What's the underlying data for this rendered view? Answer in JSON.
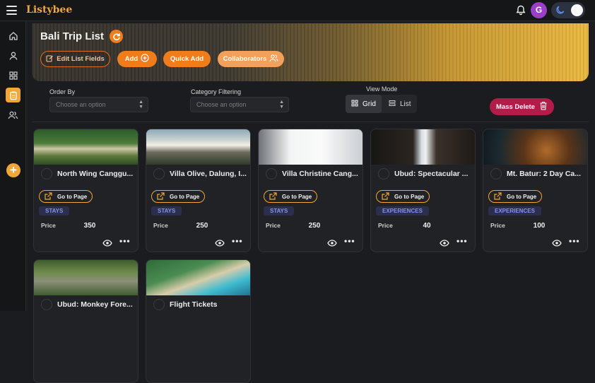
{
  "app": {
    "brand": "Listybee",
    "avatar_letter": "G"
  },
  "page": {
    "title": "Bali Trip List"
  },
  "toolbar": {
    "edit_fields": "Edit List Fields",
    "add": "Add",
    "quick_add": "Quick Add",
    "collaborators": "Collaborators"
  },
  "filters": {
    "order_by_label": "Order By",
    "order_by_placeholder": "Choose an option",
    "category_label": "Category Filtering",
    "category_placeholder": "Choose an option",
    "view_mode_label": "View Mode",
    "grid": "Grid",
    "list": "List",
    "active_view": "Grid"
  },
  "mass_delete": "Mass Delete",
  "cards": [
    {
      "name": "North Wing Canggu...",
      "goto": "Go to Page",
      "category": "STAYS",
      "price_label": "Price",
      "price": "350"
    },
    {
      "name": "Villa Olive, Dalung, I...",
      "goto": "Go to Page",
      "category": "STAYS",
      "price_label": "Price",
      "price": "250"
    },
    {
      "name": "Villa Christine Cang...",
      "goto": "Go to Page",
      "category": "STAYS",
      "price_label": "Price",
      "price": "250"
    },
    {
      "name": "Ubud: Spectacular ...",
      "goto": "Go to Page",
      "category": "EXPERIENCES",
      "price_label": "Price",
      "price": "40"
    },
    {
      "name": "Mt. Batur: 2 Day Ca...",
      "goto": "Go to Page",
      "category": "EXPERIENCES",
      "price_label": "Price",
      "price": "100"
    },
    {
      "name": "Ubud: Monkey Fore...",
      "goto": "",
      "category": "",
      "price_label": "",
      "price": ""
    },
    {
      "name": "Flight Tickets",
      "goto": "",
      "category": "",
      "price_label": "",
      "price": ""
    }
  ],
  "icons": {
    "menu": "hamburger-icon",
    "notifications": "bell-icon",
    "theme": "moon-icon",
    "sidebar": [
      "home-icon",
      "user-icon",
      "grid-icon",
      "clipboard-icon",
      "users-icon",
      "plus-icon"
    ]
  },
  "colors": {
    "accent": "#f0a73a",
    "orange": "#f07d1c",
    "delete": "#b11d48",
    "category_text": "#8592ec"
  }
}
